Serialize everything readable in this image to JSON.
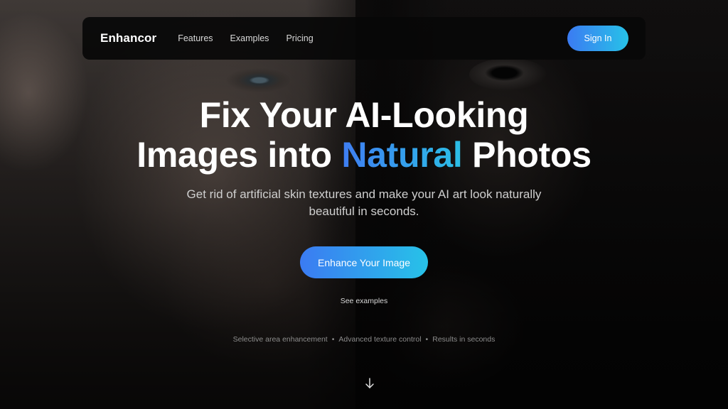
{
  "nav": {
    "logo": "Enhancor",
    "links": [
      "Features",
      "Examples",
      "Pricing"
    ],
    "sign_in": "Sign In"
  },
  "hero": {
    "headline_line1": "Fix Your AI-Looking",
    "headline_line2_before": "Images into ",
    "headline_line2_accent": "Natural",
    "headline_line2_after": " Photos",
    "subheadline": "Get rid of artificial skin textures and make your AI art look naturally beautiful in seconds.",
    "cta_label": "Enhance Your Image",
    "secondary_link": "See examples",
    "features": [
      "Selective area enhancement",
      "Advanced texture control",
      "Results in seconds"
    ],
    "feature_separator": "•",
    "scroll_icon": "arrow-down-icon"
  },
  "colors": {
    "accent_start": "#3b7bf2",
    "accent_end": "#27c2e8"
  }
}
